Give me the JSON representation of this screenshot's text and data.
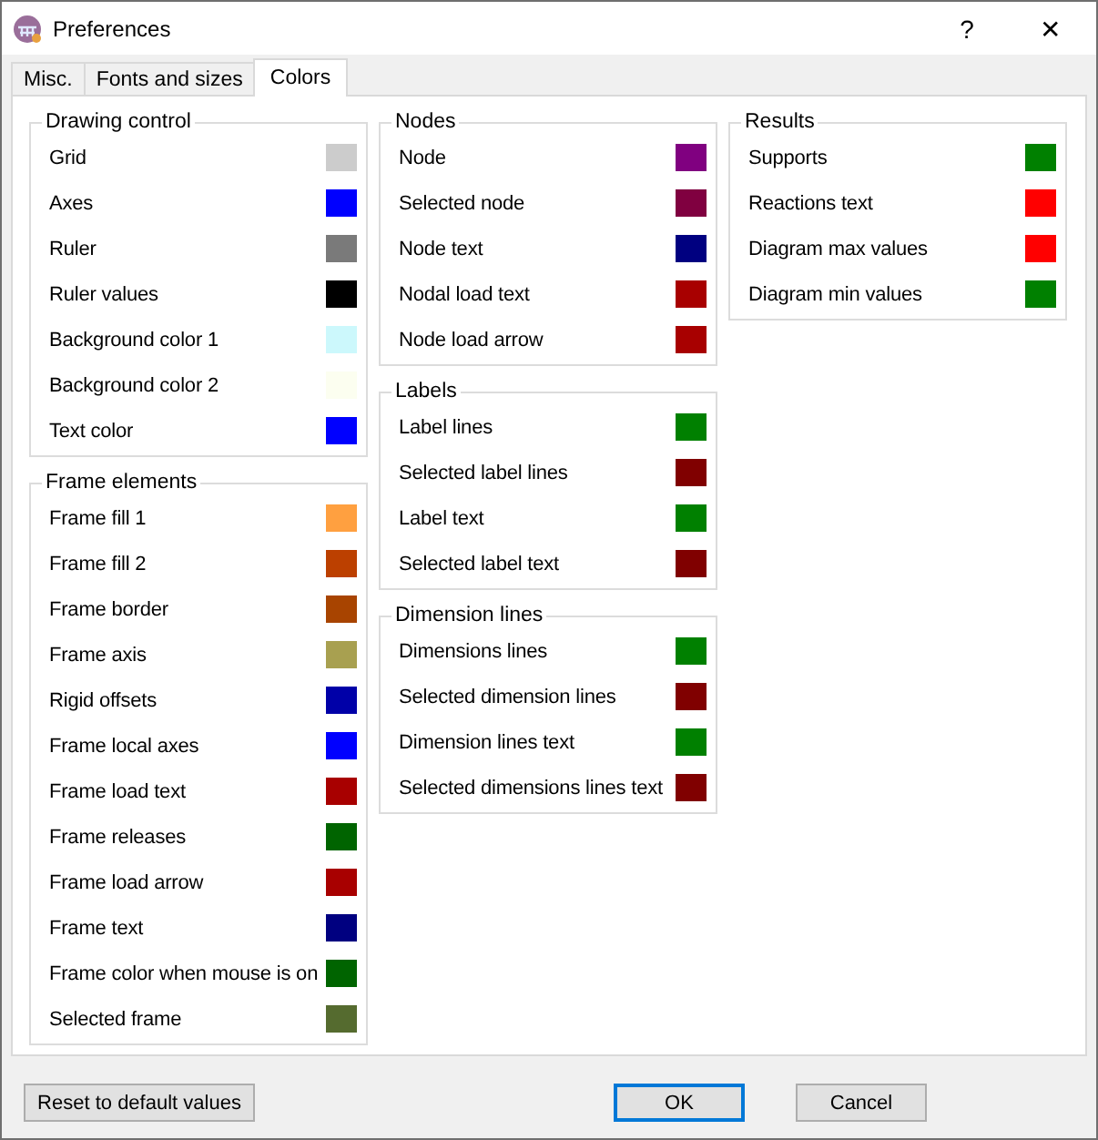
{
  "window": {
    "title": "Preferences",
    "help": "?",
    "close": "✕"
  },
  "tabs": [
    {
      "label": "Misc.",
      "selected": false
    },
    {
      "label": "Fonts and sizes",
      "selected": false
    },
    {
      "label": "Colors",
      "selected": true
    }
  ],
  "columns": [
    {
      "groups": [
        {
          "title": "Drawing control",
          "items": [
            {
              "label": "Grid",
              "color": "#cccccc"
            },
            {
              "label": "Axes",
              "color": "#0000ff"
            },
            {
              "label": "Ruler",
              "color": "#7a7a7a"
            },
            {
              "label": "Ruler values",
              "color": "#000000"
            },
            {
              "label": "Background color 1",
              "color": "#ccf8fc"
            },
            {
              "label": "Background color 2",
              "color": "#fcfef0"
            },
            {
              "label": "Text color",
              "color": "#0000ff"
            }
          ]
        },
        {
          "title": "Frame elements",
          "items": [
            {
              "label": "Frame fill 1",
              "color": "#ffa040"
            },
            {
              "label": "Frame fill 2",
              "color": "#bc4000"
            },
            {
              "label": "Frame border",
              "color": "#a84400"
            },
            {
              "label": "Frame axis",
              "color": "#a8a050"
            },
            {
              "label": "Rigid offsets",
              "color": "#0000a8"
            },
            {
              "label": "Frame local axes",
              "color": "#0000ff"
            },
            {
              "label": "Frame load text",
              "color": "#a80000"
            },
            {
              "label": "Frame releases",
              "color": "#006400"
            },
            {
              "label": "Frame load arrow",
              "color": "#a80000"
            },
            {
              "label": "Frame text",
              "color": "#000080"
            },
            {
              "label": "Frame color when mouse is on",
              "color": "#006400"
            },
            {
              "label": "Selected frame",
              "color": "#556b2f"
            }
          ]
        }
      ]
    },
    {
      "groups": [
        {
          "title": "Nodes",
          "items": [
            {
              "label": "Node",
              "color": "#800080"
            },
            {
              "label": "Selected node",
              "color": "#800040"
            },
            {
              "label": "Node text",
              "color": "#000080"
            },
            {
              "label": "Nodal load text",
              "color": "#a80000"
            },
            {
              "label": "Node load arrow",
              "color": "#a80000"
            }
          ]
        },
        {
          "title": "Labels",
          "items": [
            {
              "label": "Label lines",
              "color": "#008000"
            },
            {
              "label": "Selected label lines",
              "color": "#800000"
            },
            {
              "label": "Label text",
              "color": "#008000"
            },
            {
              "label": "Selected label text",
              "color": "#800000"
            }
          ]
        },
        {
          "title": "Dimension lines",
          "items": [
            {
              "label": "Dimensions lines",
              "color": "#008000"
            },
            {
              "label": "Selected dimension lines",
              "color": "#800000"
            },
            {
              "label": "Dimension lines text",
              "color": "#008000"
            },
            {
              "label": "Selected dimensions lines text",
              "color": "#800000"
            }
          ]
        }
      ]
    },
    {
      "groups": [
        {
          "title": "Results",
          "items": [
            {
              "label": "Supports",
              "color": "#008000"
            },
            {
              "label": "Reactions text",
              "color": "#ff0000"
            },
            {
              "label": "Diagram max values",
              "color": "#ff0000"
            },
            {
              "label": "Diagram min values",
              "color": "#008000"
            }
          ]
        }
      ]
    }
  ],
  "buttons": [
    {
      "label": "Reset to default values",
      "default": false
    },
    {
      "label": "OK",
      "default": true
    },
    {
      "label": "Cancel",
      "default": false
    }
  ]
}
